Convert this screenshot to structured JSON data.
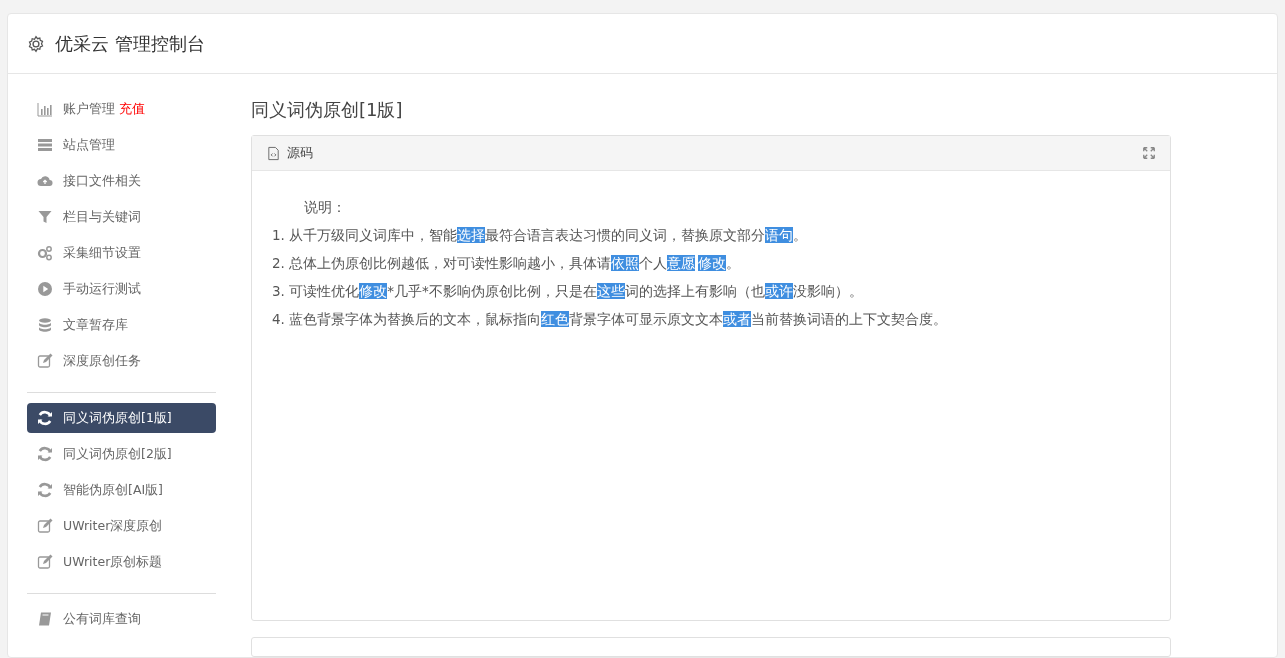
{
  "header": {
    "title": "优采云 管理控制台"
  },
  "sidebar": {
    "groups": [
      {
        "items": [
          {
            "label": "账户管理",
            "badge": "充值",
            "selected": false
          },
          {
            "label": "站点管理",
            "selected": false
          },
          {
            "label": "接口文件相关",
            "selected": false
          },
          {
            "label": "栏目与关键词",
            "selected": false
          },
          {
            "label": "采集细节设置",
            "selected": false
          },
          {
            "label": "手动运行测试",
            "selected": false
          },
          {
            "label": "文章暂存库",
            "selected": false
          },
          {
            "label": "深度原创任务",
            "selected": false
          }
        ]
      },
      {
        "items": [
          {
            "label": "同义词伪原创[1版]",
            "selected": true
          },
          {
            "label": "同义词伪原创[2版]",
            "selected": false
          },
          {
            "label": "智能伪原创[AI版]",
            "selected": false
          },
          {
            "label": "UWriter深度原创",
            "selected": false
          },
          {
            "label": "UWriter原创标题",
            "selected": false
          }
        ]
      },
      {
        "items": [
          {
            "label": "公有词库查询",
            "selected": false
          }
        ]
      }
    ]
  },
  "main": {
    "heading": "同义词伪原创[1版]",
    "panel": {
      "title": "源码",
      "intro": "说明：",
      "lines": [
        [
          {
            "text": "1. 从千万级同义词库中，智能",
            "highlighted": false
          },
          {
            "text": "选择",
            "highlighted": true
          },
          {
            "text": "最符合语言表达习惯的同义词，替换原文部分",
            "highlighted": false
          },
          {
            "text": "语句",
            "highlighted": true
          },
          {
            "text": "。",
            "highlighted": false
          }
        ],
        [
          {
            "text": "2. 总体上伪原创比例越低，对可读性影响越小，具体请",
            "highlighted": false
          },
          {
            "text": "依照",
            "highlighted": true
          },
          {
            "text": "个人",
            "highlighted": false
          },
          {
            "text": "意愿",
            "highlighted": true
          },
          {
            "text": "修改",
            "highlighted": true
          },
          {
            "text": "。",
            "highlighted": false
          }
        ],
        [
          {
            "text": "3. 可读性优化",
            "highlighted": false
          },
          {
            "text": "修改",
            "highlighted": true
          },
          {
            "text": "*几乎*不影响伪原创比例，只是在",
            "highlighted": false
          },
          {
            "text": "这些",
            "highlighted": true
          },
          {
            "text": "词的选择上有影响（也",
            "highlighted": false
          },
          {
            "text": "或许",
            "highlighted": true
          },
          {
            "text": "没影响）。",
            "highlighted": false
          }
        ],
        [
          {
            "text": "4. 蓝色背景字体为替换后的文本，鼠标指向",
            "highlighted": false
          },
          {
            "text": "红色",
            "highlighted": true
          },
          {
            "text": "背景字体可显示原文文本",
            "highlighted": false
          },
          {
            "text": "或者",
            "highlighted": true
          },
          {
            "text": "当前替换词语的上下文契合度。",
            "highlighted": false
          }
        ]
      ]
    }
  }
}
